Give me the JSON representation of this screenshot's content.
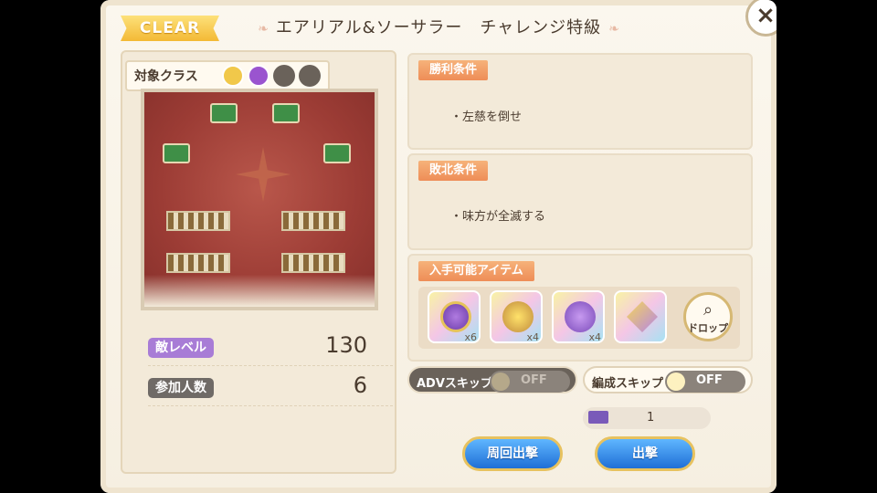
{
  "header": {
    "clear_badge": "CLEAR",
    "title": "エアリアル&ソーサラー　チャレンジ特級",
    "close_icon": "close-icon"
  },
  "left": {
    "class_label": "対象クラス",
    "class_icons": [
      "wing-icon",
      "swirl-icon",
      "empty-slot",
      "empty-slot"
    ],
    "stats": [
      {
        "label": "敵レベル",
        "value": "130",
        "color": "#a87cd6"
      },
      {
        "label": "参加人数",
        "value": "6",
        "color": "#6f6a66"
      }
    ]
  },
  "conditions": {
    "victory_tag": "勝利条件",
    "victory_text": "・左慈を倒せ",
    "defeat_tag": "敗北条件",
    "defeat_text": "・味方が全滅する",
    "items_tag": "入手可能アイテム"
  },
  "items": [
    {
      "icon": "purple-crystal-coin-icon",
      "qty": "x6"
    },
    {
      "icon": "yellow-palette-icon",
      "qty": "x4"
    },
    {
      "icon": "purple-palette-icon",
      "qty": "x4"
    },
    {
      "icon": "crystal-pendant-icon",
      "qty": ""
    }
  ],
  "drop": {
    "icon": "magnifier-icon",
    "label": "ドロップ"
  },
  "toggles": {
    "adv_skip": {
      "label": "ADVスキップ",
      "state": "OFF"
    },
    "formation_skip": {
      "label": "編成スキップ",
      "state": "OFF"
    }
  },
  "ticket": {
    "icon": "ticket-icon",
    "value": "1"
  },
  "buttons": {
    "repeat": "周回出撃",
    "sortie": "出撃"
  },
  "colors": {
    "accent_blue": "#1f6fd6",
    "badge_yellow": "#f3b935",
    "tag_orange": "#ee8d57"
  }
}
